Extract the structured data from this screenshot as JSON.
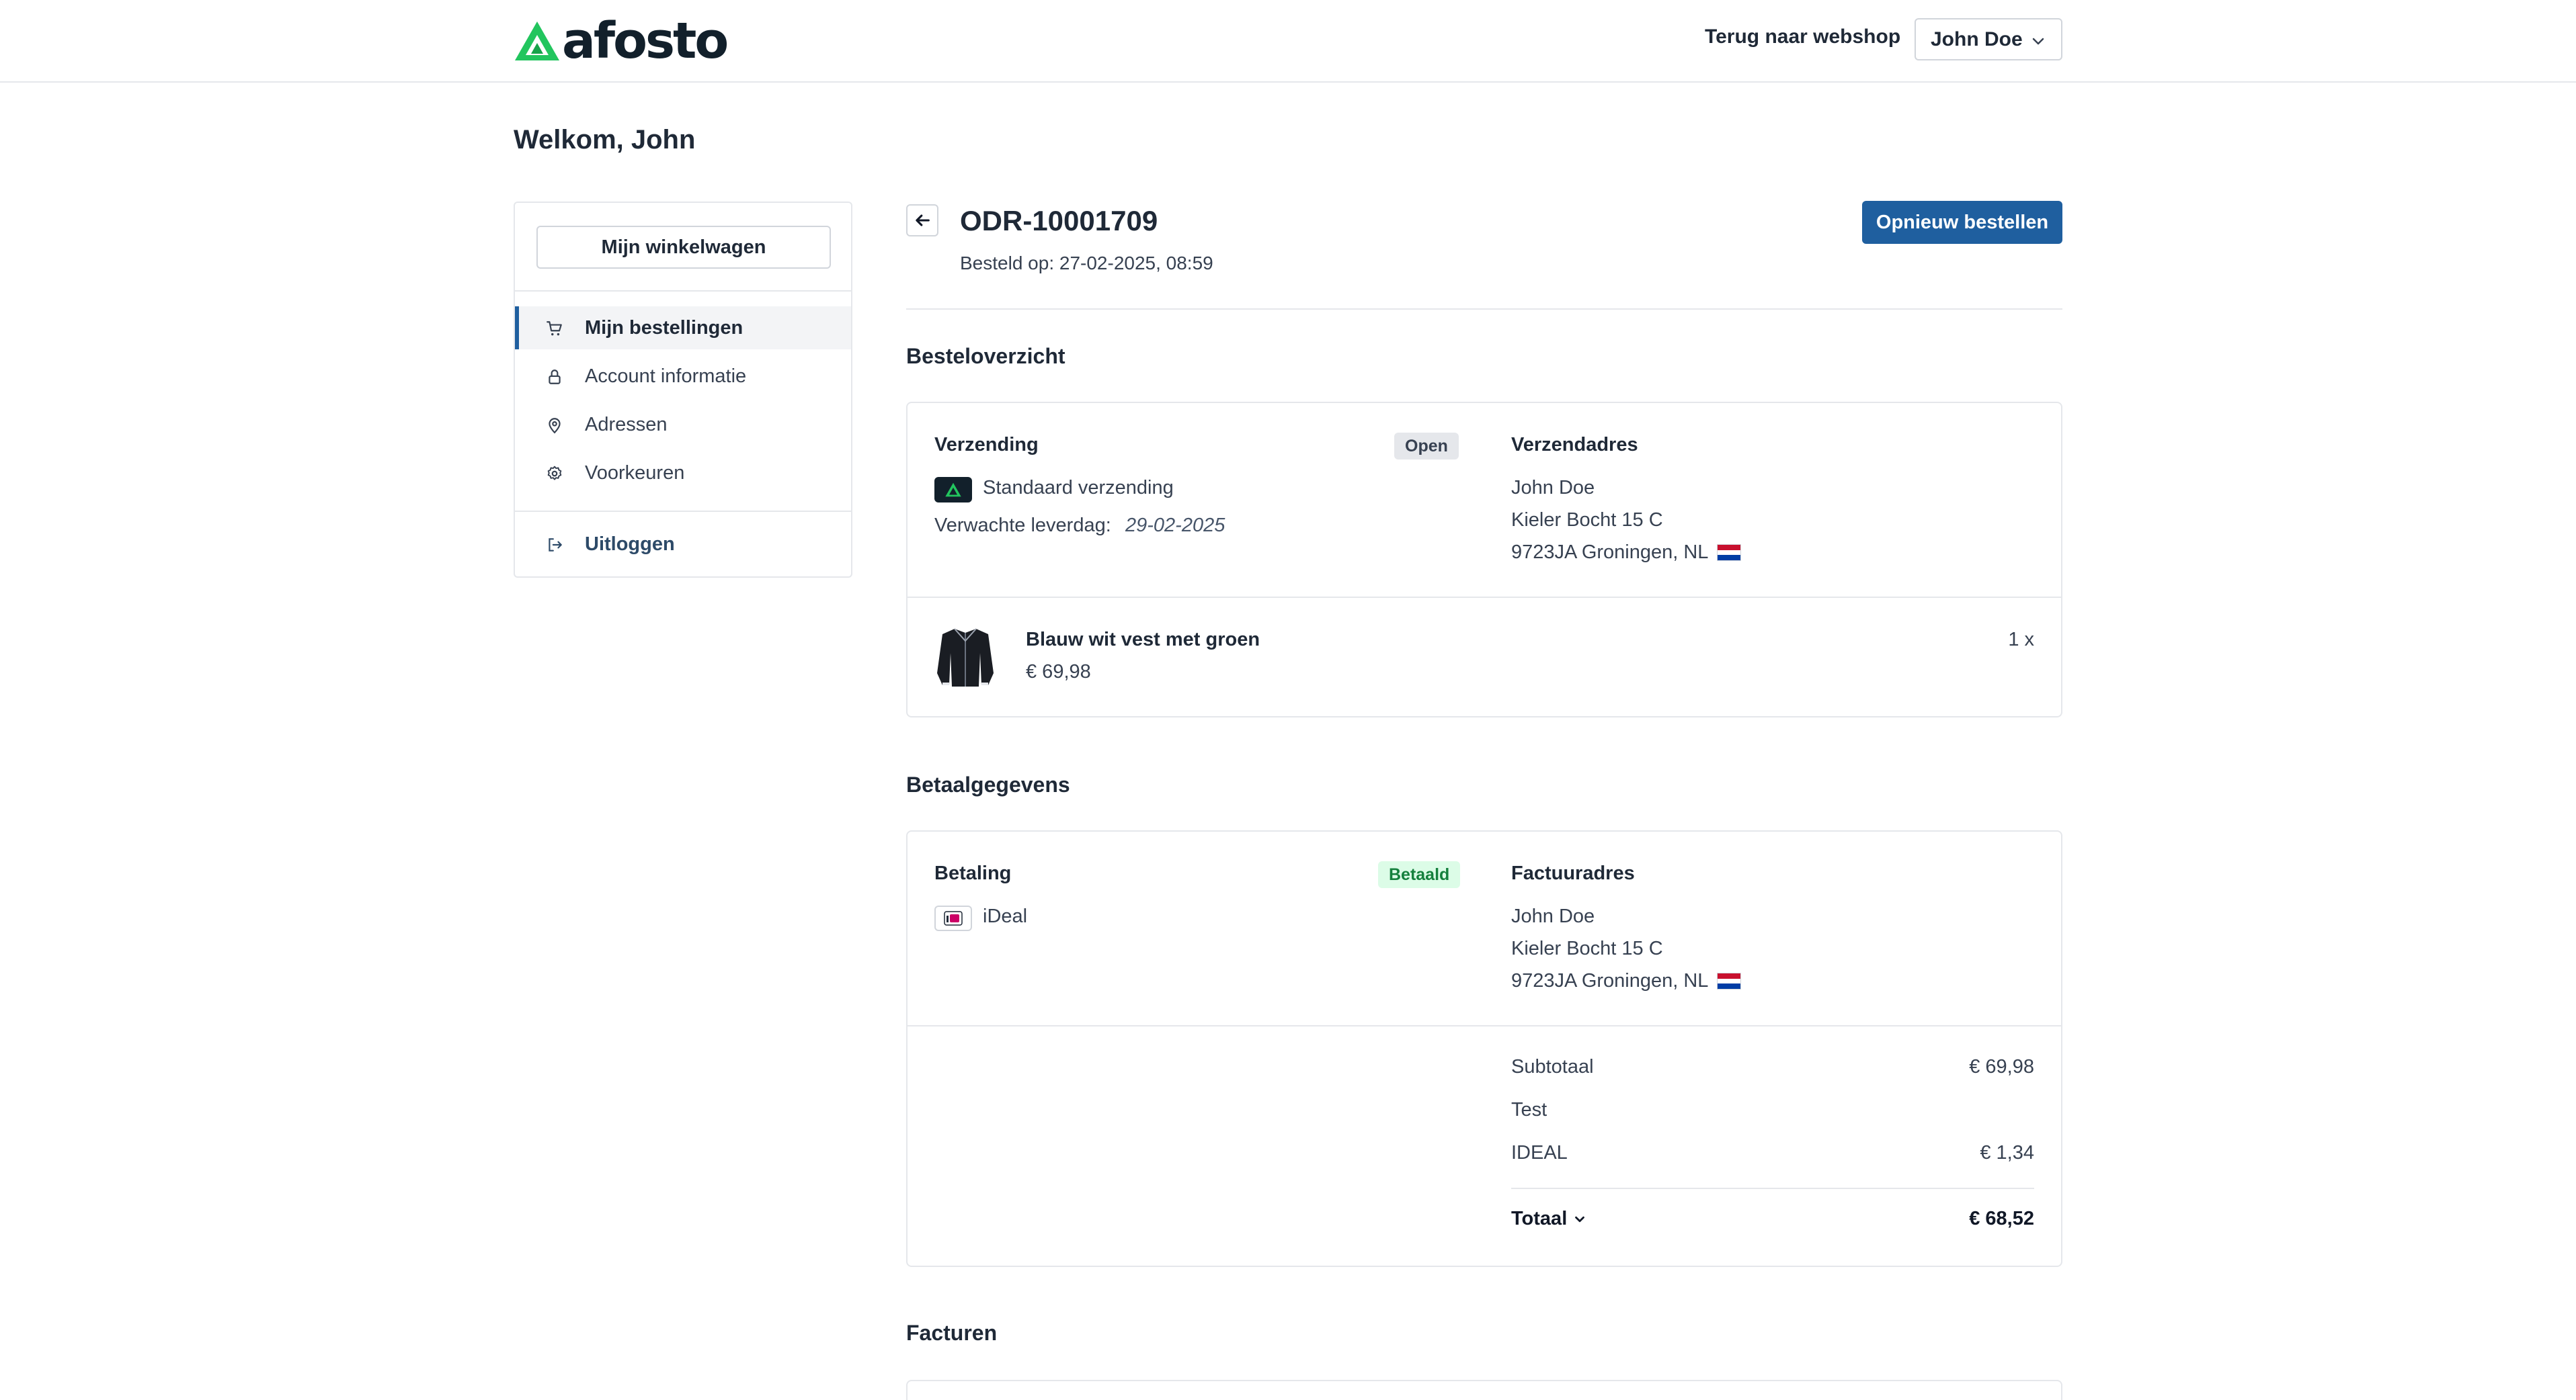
{
  "header": {
    "logo_text": "afosto",
    "back_link": "Terug naar webshop",
    "user_name": "John Doe"
  },
  "welcome": "Welkom, John",
  "sidebar": {
    "cart_button": "Mijn winkelwagen",
    "items": [
      {
        "label": "Mijn bestellingen",
        "icon": "cart-icon",
        "active": true
      },
      {
        "label": "Account informatie",
        "icon": "lock-icon",
        "active": false
      },
      {
        "label": "Adressen",
        "icon": "map-pin-icon",
        "active": false
      },
      {
        "label": "Voorkeuren",
        "icon": "gear-icon",
        "active": false
      }
    ],
    "logout": "Uitloggen"
  },
  "order": {
    "number": "ODR-10001709",
    "date": "Besteld op: 27-02-2025, 08:59",
    "reorder_button": "Opnieuw bestellen"
  },
  "overview": {
    "title": "Besteloverzicht",
    "shipping_label": "Verzending",
    "shipping_status": "Open",
    "shipping_method": "Standaard verzending",
    "delivery_label": "Verwachte leverdag:",
    "delivery_date": "29-02-2025",
    "address_label": "Verzendadres",
    "address": {
      "name": "John Doe",
      "street": "Kieler Bocht 15 C",
      "city": "9723JA Groningen, NL"
    },
    "item": {
      "name": "Blauw wit vest met groen",
      "price": "€ 69,98",
      "qty": "1 x"
    }
  },
  "payment": {
    "title": "Betaalgegevens",
    "payment_label": "Betaling",
    "payment_status": "Betaald",
    "method": "iDeal",
    "billing_label": "Factuuradres",
    "address": {
      "name": "John Doe",
      "street": "Kieler Bocht 15 C",
      "city": "9723JA Groningen, NL"
    },
    "totals": {
      "subtotal_label": "Subtotaal",
      "subtotal": "€ 69,98",
      "test_label": "Test",
      "ideal_label": "IDEAL",
      "ideal": "€ 1,34",
      "total_label": "Totaal",
      "total": "€ 68,52"
    }
  },
  "invoices_title": "Facturen",
  "colors": {
    "primary": "#1f5f9f",
    "logo_green": "#22c55e",
    "dark": "#12202b"
  }
}
